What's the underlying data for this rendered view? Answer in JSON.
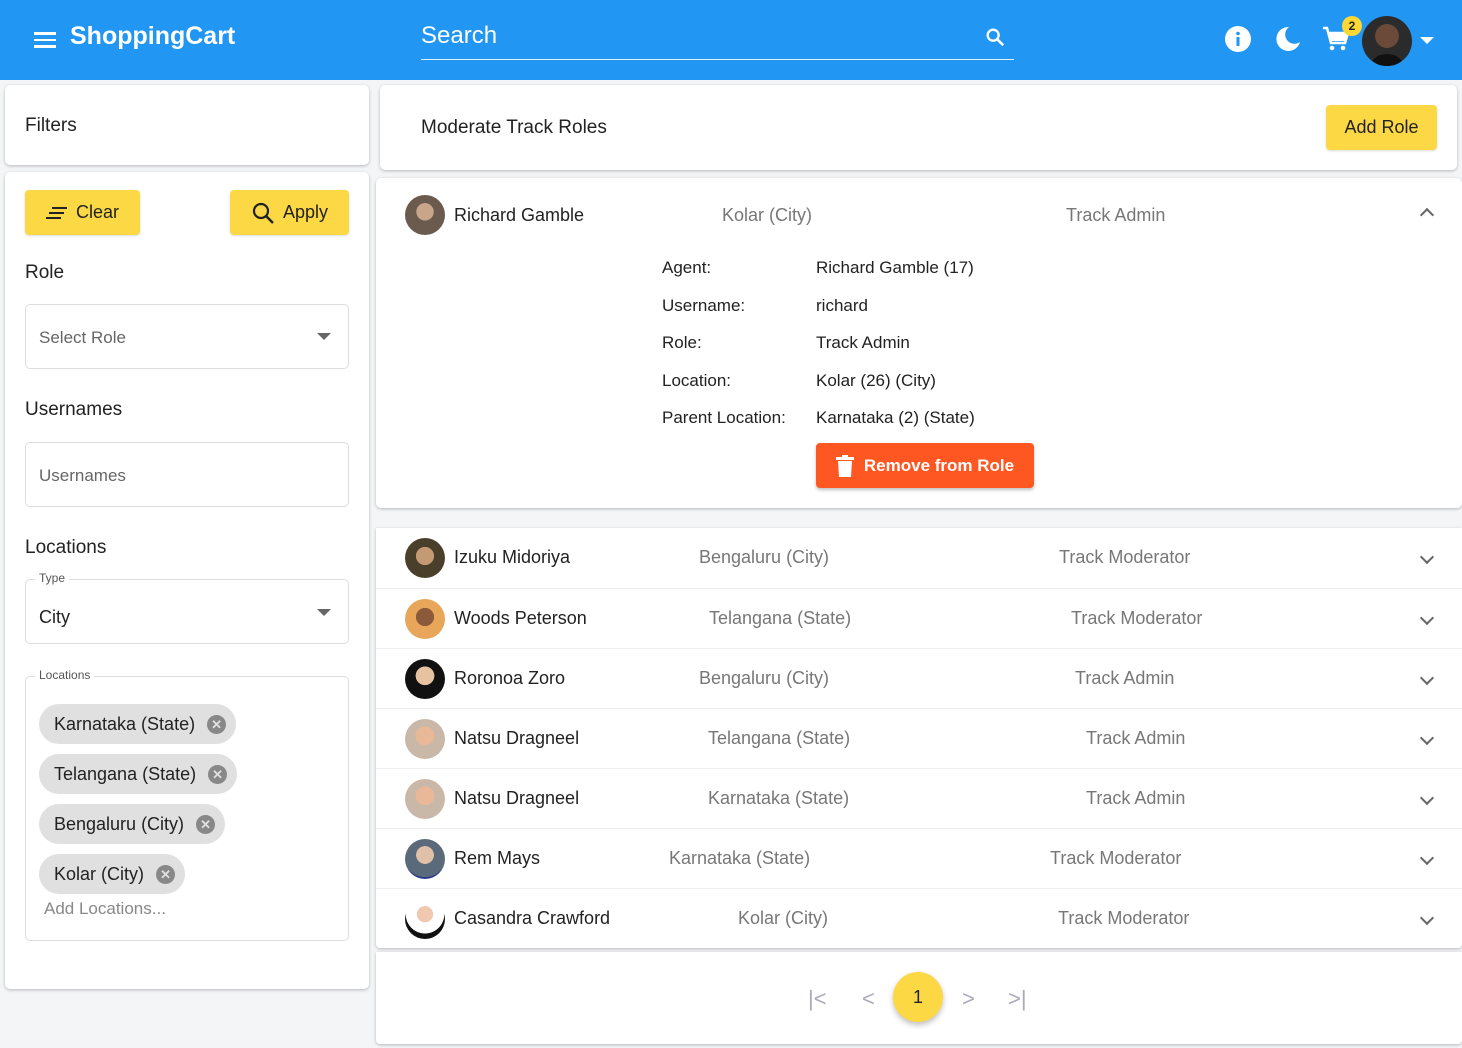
{
  "header": {
    "brand": "ShoppingCart",
    "search_placeholder": "Search",
    "cart_count": "2",
    "icons": [
      "menu-icon",
      "search-icon",
      "info-icon",
      "moon-icon",
      "cart-icon",
      "user-avatar",
      "caret-down-icon"
    ],
    "color": "#2196f3"
  },
  "filters": {
    "title": "Filters",
    "clear_label": "Clear",
    "apply_label": "Apply",
    "role_label": "Role",
    "role_placeholder": "Select Role",
    "usernames_label": "Usernames",
    "usernames_placeholder": "Usernames",
    "locations_label": "Locations",
    "type_legend": "Type",
    "type_value": "City",
    "locations_legend": "Locations",
    "chips": [
      "Karnataka (State)",
      "Telangana (State)",
      "Bengaluru (City)",
      "Kolar (City)"
    ],
    "add_locations_placeholder": "Add Locations..."
  },
  "main": {
    "title": "Moderate Track Roles",
    "add_role_label": "Add Role",
    "expanded": {
      "name": "Richard Gamble",
      "location": "Kolar (City)",
      "role": "Track Admin",
      "details": [
        {
          "label": "Agent:",
          "value": "Richard Gamble (17)"
        },
        {
          "label": "Username:",
          "value": "richard"
        },
        {
          "label": "Role:",
          "value": "Track Admin"
        },
        {
          "label": "Location:",
          "value": "Kolar (26) (City)"
        },
        {
          "label": "Parent Location:",
          "value": "Karnataka (2) (State)"
        }
      ],
      "remove_label": "Remove from Role"
    },
    "rows": [
      {
        "name": "Izuku Midoriya",
        "location": "Bengaluru (City)",
        "role": "Track Moderator"
      },
      {
        "name": "Woods Peterson",
        "location": "Telangana (State)",
        "role": "Track Moderator"
      },
      {
        "name": "Roronoa Zoro",
        "location": "Bengaluru (City)",
        "role": "Track Admin"
      },
      {
        "name": "Natsu Dragneel",
        "location": "Telangana (State)",
        "role": "Track Admin"
      },
      {
        "name": "Natsu Dragneel",
        "location": "Karnataka (State)",
        "role": "Track Admin"
      },
      {
        "name": "Rem Mays",
        "location": "Karnataka (State)",
        "role": "Track Moderator"
      },
      {
        "name": "Casandra Crawford",
        "location": "Kolar (City)",
        "role": "Track Moderator"
      }
    ],
    "pagination": {
      "first": "|<",
      "prev": "<",
      "current": "1",
      "next": ">",
      "last": ">|"
    }
  },
  "colors": {
    "accent": "#fdd845",
    "danger": "#ff5722",
    "primary": "#2196f3"
  }
}
